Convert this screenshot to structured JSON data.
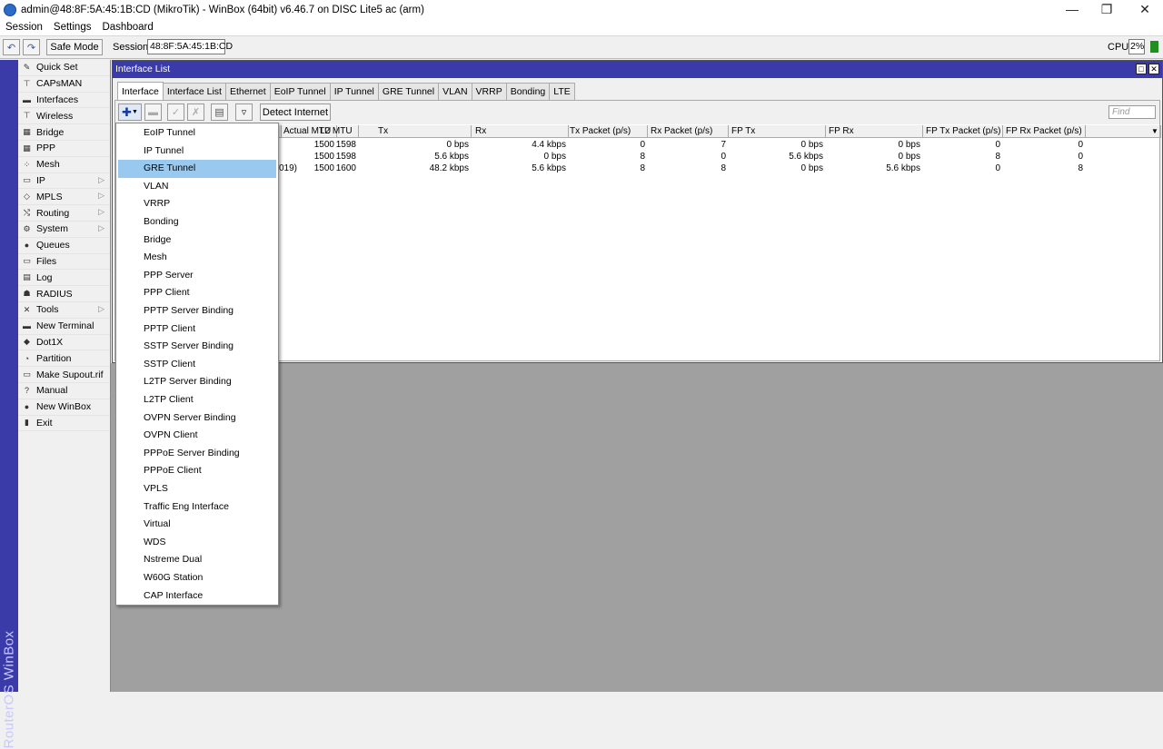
{
  "window": {
    "title": "admin@48:8F:5A:45:1B:CD (MikroTik) - WinBox (64bit) v6.46.7 on DISC Lite5 ac (arm)"
  },
  "menubar": [
    "Session",
    "Settings",
    "Dashboard"
  ],
  "toolbar": {
    "safe_mode": "Safe Mode",
    "session_label": "Session:",
    "session_value": "48:8F:5A:45:1B:CD",
    "cpu_label": "CPU:",
    "cpu_value": "2%"
  },
  "brand": "RouterOS WinBox",
  "sidebar": [
    {
      "label": "Quick Set",
      "icon": "quickset-icon",
      "arrow": false
    },
    {
      "label": "CAPsMAN",
      "icon": "capsman-icon",
      "arrow": false
    },
    {
      "label": "Interfaces",
      "icon": "interfaces-icon",
      "arrow": false
    },
    {
      "label": "Wireless",
      "icon": "wireless-icon",
      "arrow": false
    },
    {
      "label": "Bridge",
      "icon": "bridge-icon",
      "arrow": false
    },
    {
      "label": "PPP",
      "icon": "ppp-icon",
      "arrow": false
    },
    {
      "label": "Mesh",
      "icon": "mesh-icon",
      "arrow": false
    },
    {
      "label": "IP",
      "icon": "ip-icon",
      "arrow": true
    },
    {
      "label": "MPLS",
      "icon": "mpls-icon",
      "arrow": true
    },
    {
      "label": "Routing",
      "icon": "routing-icon",
      "arrow": true
    },
    {
      "label": "System",
      "icon": "system-icon",
      "arrow": true
    },
    {
      "label": "Queues",
      "icon": "queues-icon",
      "arrow": false
    },
    {
      "label": "Files",
      "icon": "files-icon",
      "arrow": false
    },
    {
      "label": "Log",
      "icon": "log-icon",
      "arrow": false
    },
    {
      "label": "RADIUS",
      "icon": "radius-icon",
      "arrow": false
    },
    {
      "label": "Tools",
      "icon": "tools-icon",
      "arrow": true
    },
    {
      "label": "New Terminal",
      "icon": "terminal-icon",
      "arrow": false
    },
    {
      "label": "Dot1X",
      "icon": "dot1x-icon",
      "arrow": false
    },
    {
      "label": "Partition",
      "icon": "partition-icon",
      "arrow": false
    },
    {
      "label": "Make Supout.rif",
      "icon": "supout-icon",
      "arrow": false
    },
    {
      "label": "Manual",
      "icon": "manual-icon",
      "arrow": false
    },
    {
      "label": "New WinBox",
      "icon": "winbox-icon",
      "arrow": false
    },
    {
      "label": "Exit",
      "icon": "exit-icon",
      "arrow": false
    }
  ],
  "interface_window": {
    "title": "Interface List",
    "tabs": [
      "Interface",
      "Interface List",
      "Ethernet",
      "EoIP Tunnel",
      "IP Tunnel",
      "GRE Tunnel",
      "VLAN",
      "VRRP",
      "Bonding",
      "LTE"
    ],
    "active_tab": "Interface",
    "detect_internet": "Detect Internet",
    "find_placeholder": "Find",
    "columns": [
      "Actual MTU",
      "L2 MTU",
      "Tx",
      "Rx",
      "Tx Packet (p/s)",
      "Rx Packet (p/s)",
      "FP Tx",
      "FP Rx",
      "FP Tx Packet (p/s)",
      "FP Rx Packet (p/s)"
    ],
    "rows": [
      {
        "name_tail": "",
        "cells": [
          "1500",
          "1598",
          "0 bps",
          "4.4 kbps",
          "0",
          "7",
          "0 bps",
          "0 bps",
          "0",
          "0"
        ]
      },
      {
        "name_tail": "",
        "cells": [
          "1500",
          "1598",
          "5.6 kbps",
          "0 bps",
          "8",
          "0",
          "5.6 kbps",
          "0 bps",
          "8",
          "0"
        ]
      },
      {
        "name_tail": "019)",
        "cells": [
          "1500",
          "1600",
          "48.2 kbps",
          "5.6 kbps",
          "8",
          "8",
          "0 bps",
          "5.6 kbps",
          "0",
          "8"
        ]
      }
    ]
  },
  "add_menu": {
    "selected": "GRE Tunnel",
    "items": [
      "EoIP Tunnel",
      "IP Tunnel",
      "GRE Tunnel",
      "VLAN",
      "VRRP",
      "Bonding",
      "Bridge",
      "Mesh",
      "PPP Server",
      "PPP Client",
      "PPTP Server Binding",
      "PPTP Client",
      "SSTP Server Binding",
      "SSTP Client",
      "L2TP Server Binding",
      "L2TP Client",
      "OVPN Server Binding",
      "OVPN Client",
      "PPPoE Server Binding",
      "PPPoE Client",
      "VPLS",
      "Traffic Eng Interface",
      "Virtual",
      "WDS",
      "Nstreme Dual",
      "W60G Station",
      "CAP Interface"
    ]
  },
  "colors": {
    "accent": "#3a3aa8",
    "selection": "#99c9ef",
    "cpu": "#1f8f1f"
  }
}
